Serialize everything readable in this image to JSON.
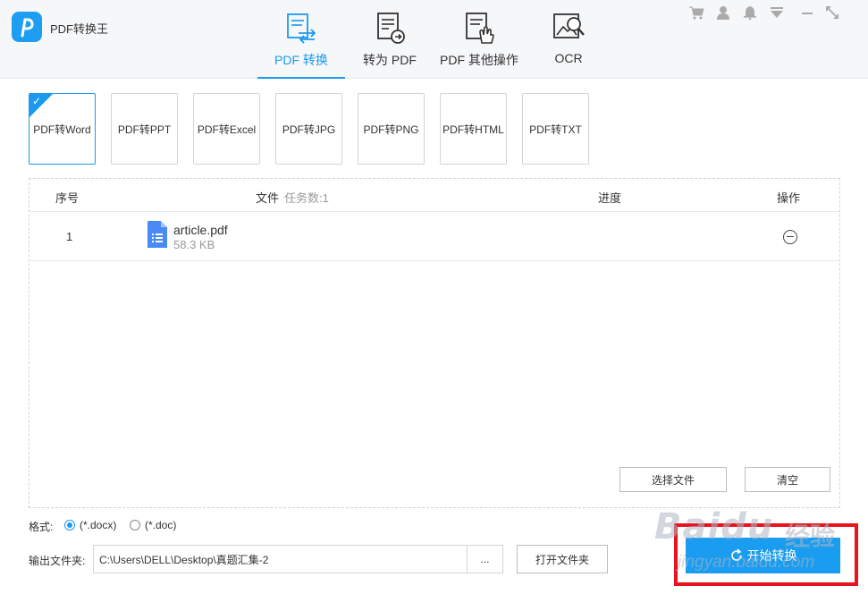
{
  "app": {
    "title": "PDF转换王",
    "logo_icon": "p-logo-icon",
    "accent": "#1b9af0"
  },
  "main_tabs": [
    {
      "label": "PDF 转换",
      "icon": "pdf-convert-icon",
      "active": true
    },
    {
      "label": "转为 PDF",
      "icon": "to-pdf-icon",
      "active": false
    },
    {
      "label": "PDF 其他操作",
      "icon": "pdf-ops-icon",
      "active": false
    },
    {
      "label": "OCR",
      "icon": "ocr-icon",
      "active": false
    }
  ],
  "window_controls": [
    "cart-icon",
    "user-icon",
    "bell-icon",
    "menu-down-icon",
    "minimize-icon",
    "maximize-icon"
  ],
  "formats": [
    {
      "label": "PDF转Word",
      "selected": true
    },
    {
      "label": "PDF转PPT",
      "selected": false
    },
    {
      "label": "PDF转Excel",
      "selected": false
    },
    {
      "label": "PDF转JPG",
      "selected": false
    },
    {
      "label": "PDF转PNG",
      "selected": false
    },
    {
      "label": "PDF转HTML",
      "selected": false
    },
    {
      "label": "PDF转TXT",
      "selected": false
    }
  ],
  "table": {
    "col_index": "序号",
    "col_file": "文件",
    "task_count": "任务数:1",
    "col_progress": "进度",
    "col_action": "操作",
    "rows": [
      {
        "index": "1",
        "name": "article.pdf",
        "size": "58.3 KB"
      }
    ]
  },
  "buttons": {
    "select_files": "选择文件",
    "clear": "清空",
    "open_folder": "打开文件夹",
    "browse": "...",
    "start": "开始转换"
  },
  "output_format": {
    "label": "格式:",
    "options": [
      {
        "label": "(*.docx)",
        "checked": true
      },
      {
        "label": "(*.doc)",
        "checked": false
      }
    ]
  },
  "output_folder": {
    "label": "输出文件夹:",
    "value": "C:\\Users\\DELL\\Desktop\\真题汇集-2"
  },
  "watermark": {
    "brand": "Baidu",
    "cn": "经验",
    "url": "jingyan.baidu.com"
  },
  "highlight_color": "#e8131c"
}
